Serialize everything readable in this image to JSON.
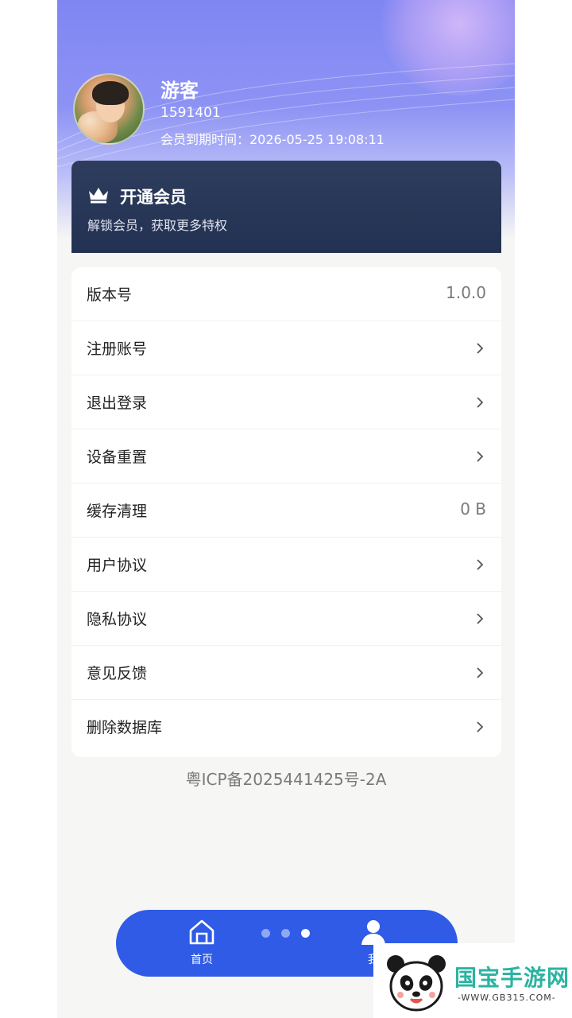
{
  "profile": {
    "name": "游客",
    "id": "1591401",
    "expiry": "会员到期时间：2026-05-25 19:08:11"
  },
  "vip": {
    "title": "开通会员",
    "subtitle": "解锁会员，获取更多特权",
    "icon": "crown-icon"
  },
  "settings": {
    "items": [
      {
        "label": "版本号",
        "value": "1.0.0"
      },
      {
        "label": "注册账号",
        "icon": "chevron-right-icon"
      },
      {
        "label": "退出登录",
        "icon": "chevron-right-icon"
      },
      {
        "label": "设备重置",
        "icon": "chevron-right-icon"
      },
      {
        "label": "缓存清理",
        "value": "0 B"
      },
      {
        "label": "用户协议",
        "icon": "chevron-right-icon"
      },
      {
        "label": "隐私协议",
        "icon": "chevron-right-icon"
      },
      {
        "label": "意见反馈",
        "icon": "chevron-right-icon"
      },
      {
        "label": "删除数据库",
        "icon": "chevron-right-icon"
      }
    ]
  },
  "footer": {
    "icp": "粤ICP备2025441425号-2A"
  },
  "tabbar": {
    "home_label": "首页",
    "me_label": "我",
    "pager_active": 3,
    "pager_total": 3
  },
  "watermark": {
    "title": "国宝手游网",
    "url": "-WWW.GB315.COM-"
  },
  "colors": {
    "header_accent": "#8d93f4",
    "vip_card": "#2a3858",
    "tabbar": "#2f5be6",
    "watermark": "#2bb3a2"
  }
}
